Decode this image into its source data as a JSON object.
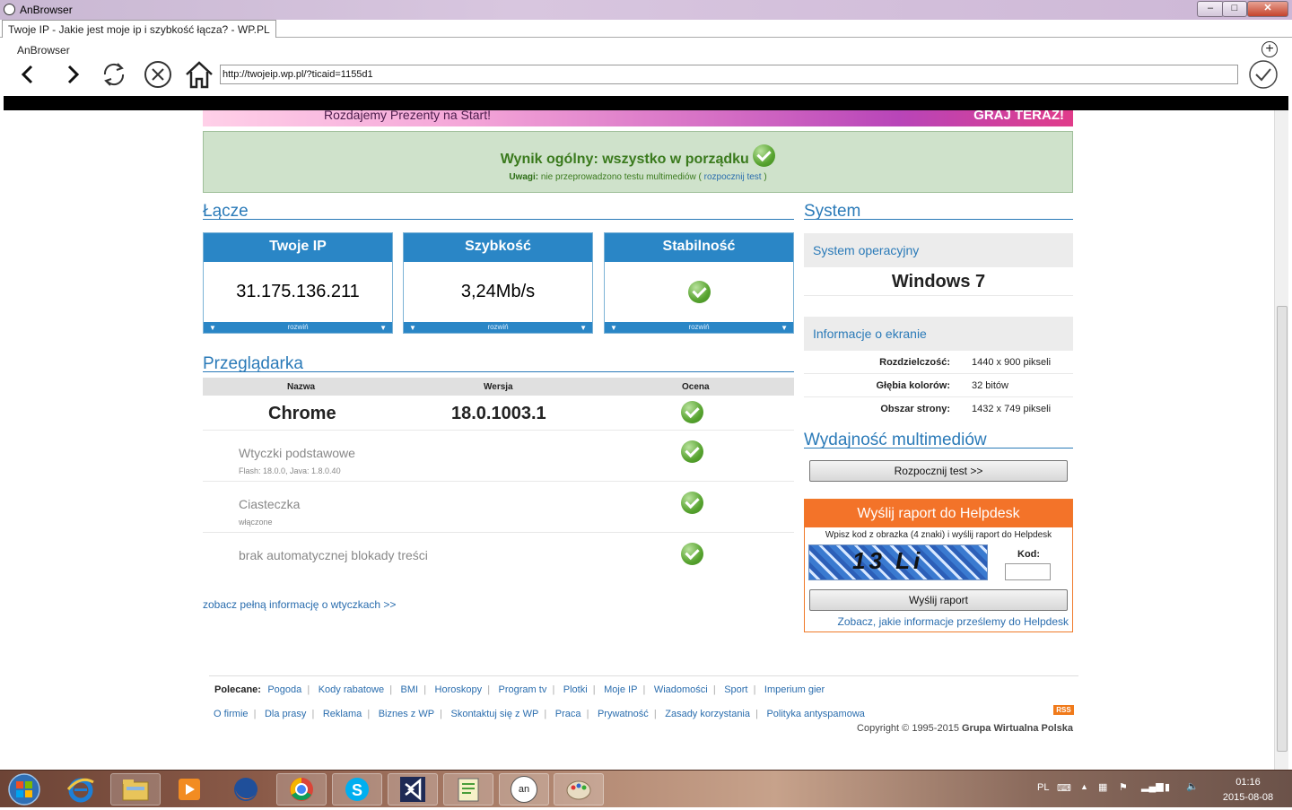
{
  "window": {
    "title": "AnBrowser",
    "buttons": [
      "–",
      "□",
      "✕"
    ]
  },
  "tab": {
    "label": "Twoje IP - Jakie jest moje ip i szybkość łącza? - WP.PL"
  },
  "browser": {
    "brand": "AnBrowser",
    "url": "http://twojeip.wp.pl/?ticaid=1155d1",
    "new_tab": "+"
  },
  "banner": {
    "text": "Rozdajemy Prezenty na Start!",
    "cta": "GRAJ TERAZ!"
  },
  "result": {
    "main": "Wynik ogólny: wszystko w porządku",
    "sub_label": "Uwagi:",
    "sub_text": " nie przeprowadzono testu multimediów ( ",
    "sub_link": "rozpocznij test",
    "sub_end": " )"
  },
  "lacze": {
    "heading": "Łącze",
    "cards": [
      {
        "title": "Twoje IP",
        "value": "31.175.136.211",
        "footer": "rozwiń"
      },
      {
        "title": "Szybkość",
        "value": "3,24Mb/s",
        "footer": "rozwiń"
      },
      {
        "title": "Stabilność",
        "value": "",
        "footer": "rozwiń"
      }
    ]
  },
  "przegladarka": {
    "heading": "Przeglądarka",
    "cols": [
      "Nazwa",
      "Wersja",
      "Ocena"
    ],
    "name": "Chrome",
    "version": "18.0.1003.1",
    "rows": [
      {
        "title": "Wtyczki podstawowe",
        "sub": "Flash: 18.0.0, Java: 1.8.0.40"
      },
      {
        "title": "Ciasteczka",
        "sub": "włączone"
      },
      {
        "title": "brak automatycznej blokady treści",
        "sub": ""
      }
    ],
    "link": "zobacz pełną informację o wtyczkach >>"
  },
  "system": {
    "heading": "System",
    "os_label": "System operacyjny",
    "os": "Windows 7",
    "screen_label": "Informacje o ekranie",
    "info": [
      {
        "k": "Rozdzielczość:",
        "v": "1440 x 900 pikseli"
      },
      {
        "k": "Głębia kolorów:",
        "v": "32 bitów"
      },
      {
        "k": "Obszar strony:",
        "v": "1432 x 749 pikseli"
      }
    ]
  },
  "multimedia": {
    "heading": "Wydajność multimediów",
    "button": "Rozpocznij test >>"
  },
  "helpdesk": {
    "title": "Wyślij raport do Helpdesk",
    "instr": "Wpisz kod z obrazka (4 znaki) i wyślij raport do Helpdesk",
    "captcha": "13 Li",
    "code_label": "Kod:",
    "button": "Wyślij raport",
    "link": "Zobacz, jakie informacje prześlemy do Helpdesk"
  },
  "footer": {
    "polecane_label": "Polecane:",
    "polecane": [
      "Pogoda",
      "Kody rabatowe",
      "BMI",
      "Horoskopy",
      "Program tv",
      "Plotki",
      "Moje IP",
      "Wiadomości",
      "Sport",
      "Imperium gier"
    ],
    "links": [
      "O firmie",
      "Dla prasy",
      "Reklama",
      "Biznes z WP",
      "Skontaktuj się z WP",
      "Praca",
      "Prywatność",
      "Zasady korzystania",
      "Polityka antyspamowa"
    ],
    "rss": "RSS",
    "copyright": "Copyright © 1995-2015 ",
    "copyright_bold": "Grupa Wirtualna Polska"
  },
  "taskbar": {
    "lang": "PL",
    "time": "01:16",
    "date": "2015-08-08",
    "an_label": "an"
  }
}
